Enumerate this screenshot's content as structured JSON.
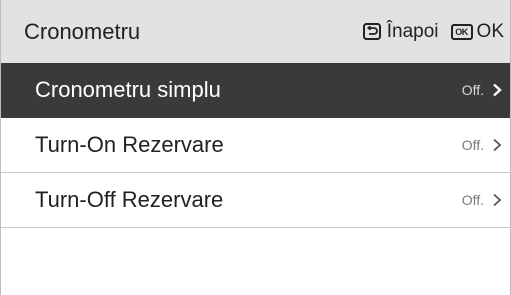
{
  "header": {
    "title": "Cronometru",
    "back_label": "Înapoi",
    "ok_icon_text": "OK",
    "ok_label": "OK"
  },
  "menu": {
    "items": [
      {
        "label": "Cronometru simplu",
        "value": "Off.",
        "selected": true
      },
      {
        "label": "Turn-On Rezervare",
        "value": "Off.",
        "selected": false
      },
      {
        "label": "Turn-Off Rezervare",
        "value": "Off.",
        "selected": false
      }
    ]
  },
  "colors": {
    "header_bg": "#e2e2e2",
    "selected_bg": "#3a3a3a",
    "value_text": "#7a7a7a"
  },
  "icons": {
    "back": "back-return-icon",
    "ok": "ok-key-icon",
    "chevron": "chevron-right-icon"
  }
}
